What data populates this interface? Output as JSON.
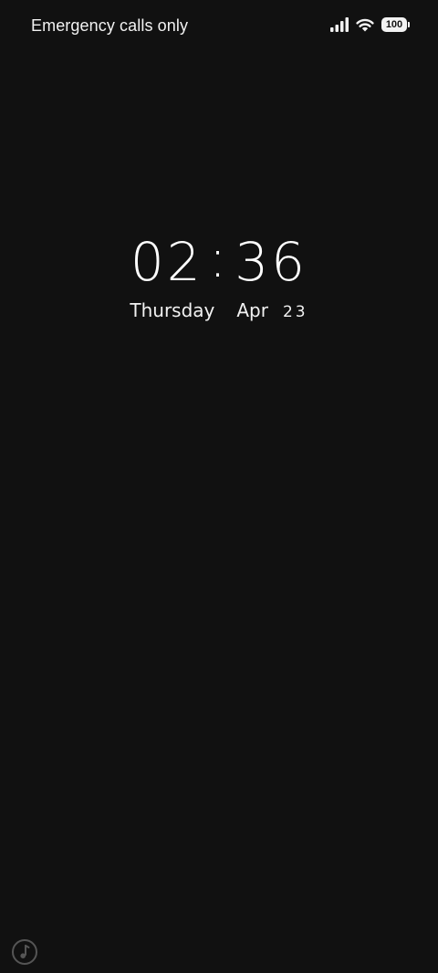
{
  "status_bar": {
    "carrier_text": "Emergency calls only",
    "battery_level": "100",
    "signal_icon": "signal-bars-icon",
    "wifi_icon": "wifi-icon"
  },
  "clock": {
    "hours": "02",
    "separator": ":",
    "minutes": "36"
  },
  "date": {
    "weekday": "Thursday",
    "month": "Apr",
    "day": "23"
  },
  "bottom": {
    "icon": "music-note-icon"
  },
  "colors": {
    "background": "#111111",
    "text": "#ffffff"
  }
}
